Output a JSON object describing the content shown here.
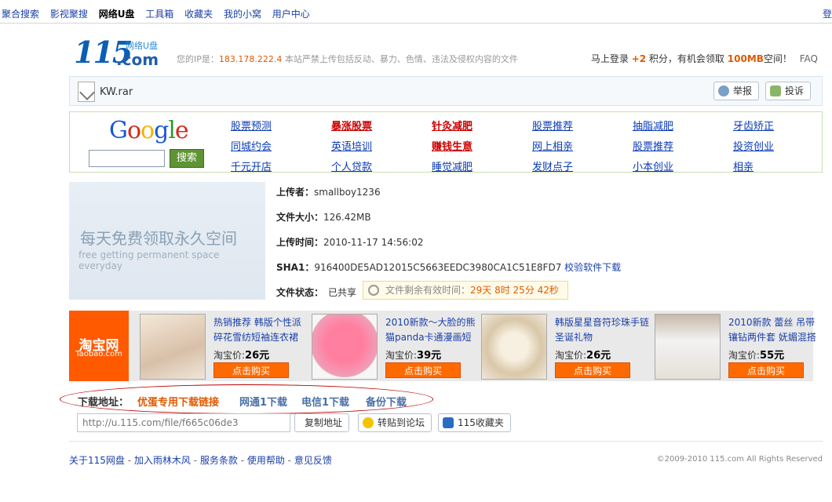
{
  "topnav": {
    "items": [
      "聚合搜索",
      "影视聚搜",
      "网络U盘",
      "工具箱",
      "收藏夹",
      "我的小窝",
      "用户中心"
    ],
    "active_index": 2,
    "edge_text": "登"
  },
  "logo": {
    "number": "115",
    "sub": "网络U盘",
    "com": ".com"
  },
  "ipline": {
    "prefix": "您的IP是：",
    "ip": "183.178.222.4",
    "notice": " 本站严禁上传包括反动、暴力、色情、违法及侵权内容的文件"
  },
  "login": {
    "text1": "马上登录",
    "points": "+2",
    "text2": "积分，有机会领取",
    "mb": "100MB",
    "text3": "空间！",
    "faq": "FAQ"
  },
  "file": {
    "name": "KW.rar",
    "report_label": "举报",
    "complain_label": "投诉"
  },
  "google": {
    "logo": "Google",
    "search_label": "搜索"
  },
  "ad_links": [
    [
      "股票预测",
      "暴涨股票",
      "针灸减肥",
      "股票推荐",
      "抽脂减肥",
      "牙齿矫正"
    ],
    [
      "同城约会",
      "英语培训",
      "赚钱生意",
      "网上相亲",
      "股票推荐",
      "投资创业"
    ],
    [
      "千元开店",
      "个人贷款",
      "睡觉减肥",
      "发财点子",
      "小本创业",
      "相亲"
    ]
  ],
  "promo": {
    "line1": "每天免费领取永久空间",
    "line2": "free getting permanent space everyday"
  },
  "info": {
    "uploader_label": "上传者：",
    "uploader": "smallboy1236",
    "size_label": "文件大小：",
    "size": "126.42MB",
    "time_label": "上传时间：",
    "time": "2010-11-17 14:56:02",
    "sha1_label": "SHA1：",
    "sha1": "916400DE5AD12015C5663EEDC3980CA1C51E8FD7",
    "sha1_link": "校验软件下载",
    "status_label": "文件状态：",
    "status": "已共享",
    "expire_prefix": "文件剩余有效时间：",
    "expire_value": "29天 8时 25分 42秒"
  },
  "taobao": {
    "logo_cn": "淘宝网",
    "logo_en": "Taobao.com",
    "items": [
      {
        "desc": "热销推荐 韩版个性派碎花雪纺短袖连衣裙",
        "price_label": "淘宝价:",
        "price": "26元",
        "buy": "点击购买"
      },
      {
        "desc": "2010新款～大脸的熊猫panda卡通漫画短",
        "price_label": "淘宝价:",
        "price": "39元",
        "buy": "点击购买"
      },
      {
        "desc": "韩版星星音符珍珠手链圣诞礼物",
        "price_label": "淘宝价:",
        "price": "26元",
        "buy": "点击购买"
      },
      {
        "desc": "2010新款 蕾丝 吊带 镶钻两件套 妩媚混搭",
        "price_label": "淘宝价:",
        "price": "55元",
        "buy": "点击购买"
      }
    ]
  },
  "download": {
    "label": "下载地址：",
    "link1": "优蛋专用下载链接",
    "link2": "网通1下载",
    "link3": "电信1下载",
    "link4": "备份下载",
    "url": "http://u.115.com/file/f665c06de3",
    "copy_label": "复制地址",
    "forum_label": "转贴到论坛",
    "fav_label": "115收藏夹"
  },
  "footer": {
    "links": [
      "关于115网盘",
      "加入雨林木风",
      "服务条款",
      "使用帮助",
      "意见反馈"
    ],
    "sep": " - ",
    "copyright": "©2009-2010 115.com All Rights Reserved"
  },
  "colors": {
    "accent_orange": "#e05a00",
    "link_blue": "#0b3bb5",
    "taobao_orange": "#ff5a00",
    "google_green": "#5f9434"
  }
}
